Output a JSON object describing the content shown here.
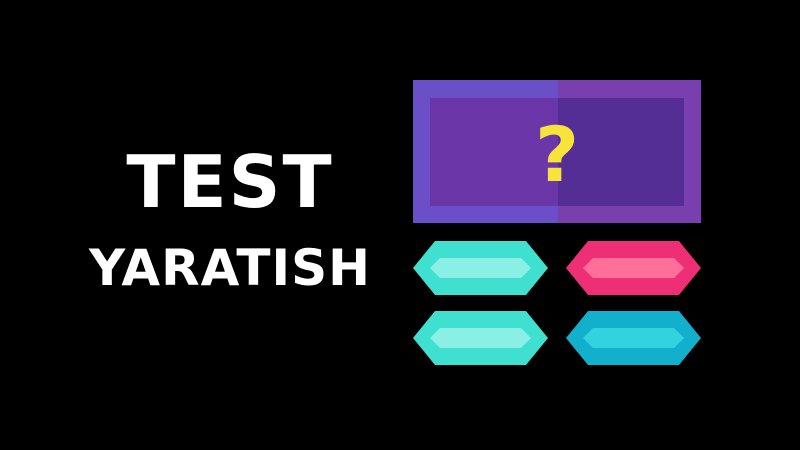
{
  "title": {
    "line1": "TEST",
    "line2": "YARATISH"
  },
  "illustration": {
    "question_mark": "?",
    "icon": "quiz-question-icon",
    "colors": {
      "background": "#000000",
      "text": "#ffffff",
      "board_frame_left": "#6a4fc8",
      "board_frame_right": "#7a3fae",
      "board_inner_left": "#6a36a8",
      "board_inner_right": "#542e95",
      "question_mark": "#f7e43b",
      "answer_teal": "#3fe0d0",
      "answer_teal_light": "#8af0e6",
      "answer_pink": "#ee2f76",
      "answer_pink_light": "#ff6f9a",
      "answer_blue": "#12b0cc",
      "answer_blue_light": "#33d2df"
    },
    "answer_options": [
      {
        "name": "answer-option-top-left",
        "color": "teal"
      },
      {
        "name": "answer-option-top-right",
        "color": "pink"
      },
      {
        "name": "answer-option-bottom-left",
        "color": "teal"
      },
      {
        "name": "answer-option-bottom-right",
        "color": "blue"
      }
    ]
  }
}
